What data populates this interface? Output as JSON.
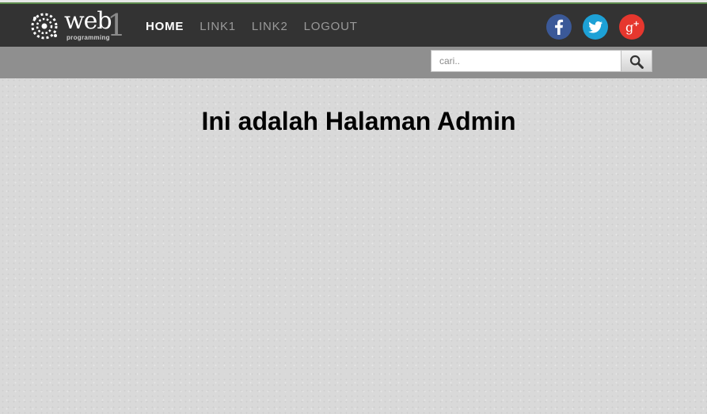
{
  "brand": {
    "word": "web",
    "number": "1",
    "tagline": "programming"
  },
  "nav": {
    "links": [
      {
        "label": "HOME",
        "active": true
      },
      {
        "label": "LINK1",
        "active": false
      },
      {
        "label": "LINK2",
        "active": false
      },
      {
        "label": "LOGOUT",
        "active": false
      }
    ]
  },
  "social": [
    {
      "icon": "facebook-icon",
      "glyph": "f",
      "color": "#3b5998"
    },
    {
      "icon": "twitter-icon",
      "glyph": "bird",
      "color": "#1da1d6"
    },
    {
      "icon": "google-plus-icon",
      "glyph": "g+",
      "color": "#e6372e"
    }
  ],
  "search": {
    "placeholder": "cari..",
    "value": "",
    "button_icon": "search-icon"
  },
  "main": {
    "heading": "Ini adalah Halaman Admin"
  },
  "colors": {
    "navbar": "#333333",
    "subbar": "#8f8f8f",
    "page_background": "#d9d9d9",
    "top_accent": "#5c8a4c"
  }
}
